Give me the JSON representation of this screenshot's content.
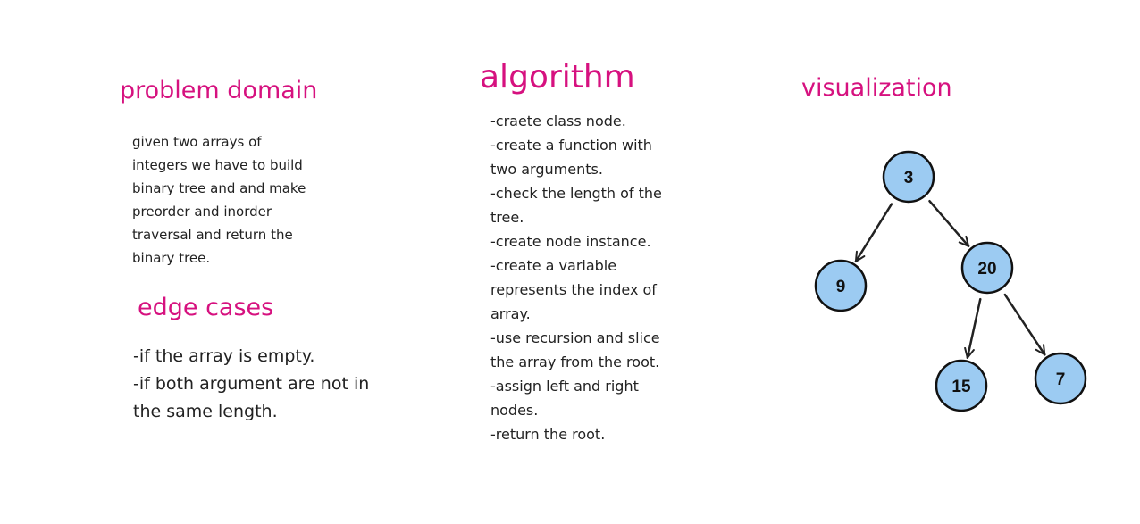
{
  "problem_domain": {
    "title": "problem domain",
    "lines": [
      "given two arrays of",
      "integers we have to build",
      "binary tree and and make",
      "preorder and inorder",
      "traversal and return the",
      "binary tree."
    ]
  },
  "edge_cases": {
    "title": "edge cases",
    "lines": [
      "-if the array is empty.",
      "-if both argument are not in",
      "the same length."
    ]
  },
  "algorithm": {
    "title": "algorithm",
    "lines": [
      "-craete class node.",
      "-create a function with",
      "two arguments.",
      "-check the length of the",
      "tree.",
      "-create node instance.",
      "-create a variable",
      "represents the index of",
      "array.",
      "-use recursion and slice",
      "the array from the root.",
      "-assign left and right",
      "nodes.",
      "-return the root."
    ]
  },
  "visualization": {
    "title": "visualization",
    "node_fill": "#9ccbf2",
    "node_stroke": "#111111",
    "edge_color": "#222222",
    "nodes": [
      {
        "id": "n3",
        "label": "3"
      },
      {
        "id": "n9",
        "label": "9"
      },
      {
        "id": "n20",
        "label": "20"
      },
      {
        "id": "n15",
        "label": "15"
      },
      {
        "id": "n7",
        "label": "7"
      }
    ],
    "edges": [
      {
        "from": "n3",
        "to": "n9"
      },
      {
        "from": "n3",
        "to": "n20"
      },
      {
        "from": "n20",
        "to": "n15"
      },
      {
        "from": "n20",
        "to": "n7"
      }
    ]
  }
}
